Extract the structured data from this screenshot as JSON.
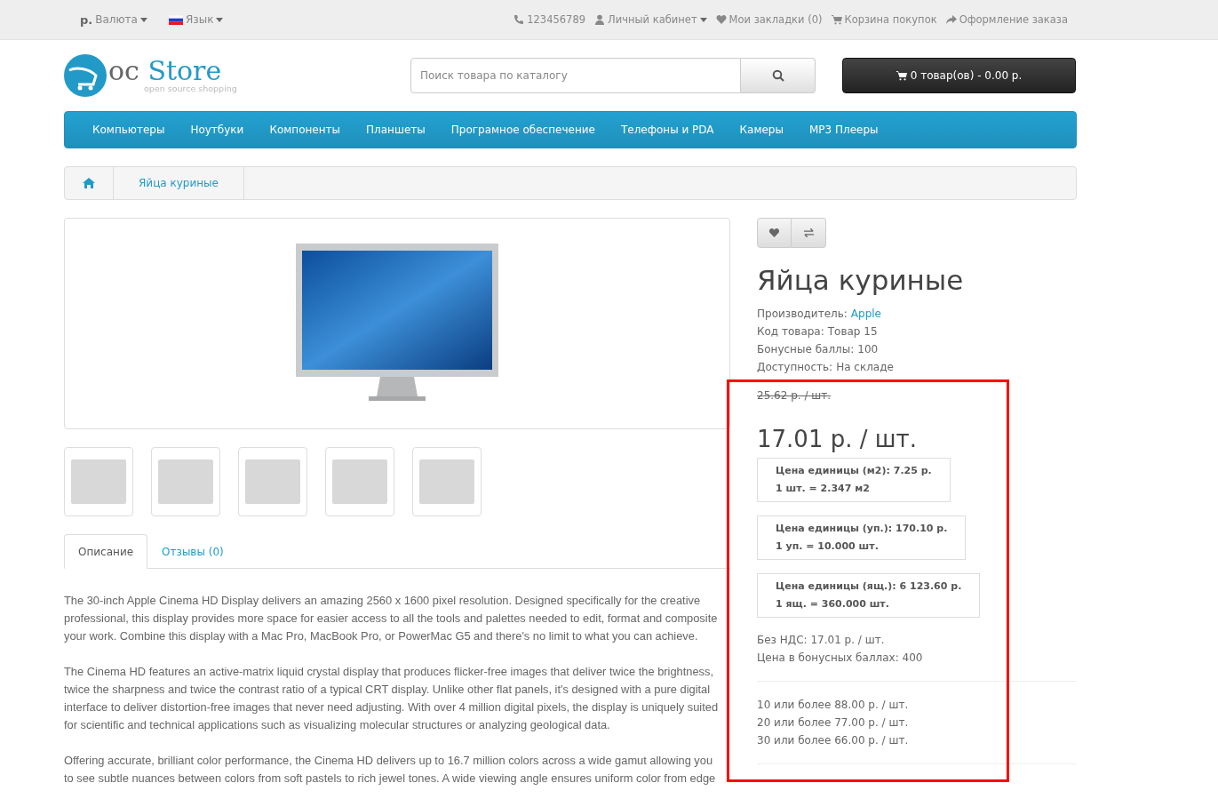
{
  "top_bar": {
    "currency": {
      "symbol": "р.",
      "label": "Валюта"
    },
    "language": {
      "label": "Язык"
    },
    "links": [
      {
        "kind": "phone",
        "label": "123456789",
        "dropdown": false
      },
      {
        "kind": "user",
        "label": "Личный кабинет",
        "dropdown": true
      },
      {
        "kind": "heart",
        "label": "Мои закладки (0)",
        "dropdown": false
      },
      {
        "kind": "cart",
        "label": "Корзина покупок",
        "dropdown": false
      },
      {
        "kind": "share",
        "label": "Оформление заказа",
        "dropdown": false
      }
    ]
  },
  "header": {
    "logo": {
      "prefix": "oc",
      "name": "Store",
      "tagline": "open source shopping"
    },
    "search": {
      "placeholder": "Поиск товара по каталогу"
    },
    "cart": {
      "label": "0 товар(ов) - 0.00 р."
    }
  },
  "menu": [
    "Компьютеры",
    "Ноутбуки",
    "Компоненты",
    "Планшеты",
    "Програмное обеспечение",
    "Телефоны и PDA",
    "Камеры",
    "MP3 Плееры"
  ],
  "breadcrumb": [
    {
      "label": "Яйца куриные"
    }
  ],
  "tabs": [
    {
      "label": "Описание",
      "selected": true
    },
    {
      "label": "Отзывы (0)",
      "selected": false
    }
  ],
  "description": [
    "The 30-inch Apple Cinema HD Display delivers an amazing 2560 x 1600 pixel resolution. Designed specifically for the creative professional, this display provides more space for easier access to all the tools and palettes needed to edit, format and composite your work. Combine this display with a Mac Pro, MacBook Pro, or PowerMac G5 and there's no limit to what you can achieve.",
    "The Cinema HD features an active-matrix liquid crystal display that produces flicker-free images that deliver twice the brightness, twice the sharpness and twice the contrast ratio of a typical CRT display. Unlike other flat panels, it's designed with a pure digital interface to deliver distortion-free images that never need adjusting. With over 4 million digital pixels, the display is uniquely suited for scientific and technical applications such as visualizing molecular structures or analyzing geological data.",
    "Offering accurate, brilliant color performance, the Cinema HD delivers up to 16.7 million colors across a wide gamut allowing you to see subtle nuances between colors from soft pastels to rich jewel tones. A wide viewing angle ensures uniform color from edge"
  ],
  "product": {
    "title": "Яйца куриные",
    "attributes": [
      {
        "label": "Производитель:",
        "value": "Apple",
        "link": true
      },
      {
        "label": "Код товара:",
        "value": "Товар 15",
        "link": false
      },
      {
        "label": "Бонусные баллы:",
        "value": "100",
        "link": false
      },
      {
        "label": "Доступность:",
        "value": "На складе",
        "link": false
      }
    ],
    "old_price": "25.62 р. / шт.",
    "price": "17.01 р. / шт.",
    "unit_prices": [
      {
        "price": "Цена единицы (м2): 7.25 р.",
        "ratio": "1 шт. = 2.347 м2"
      },
      {
        "price": "Цена единицы (уп.): 170.10 р.",
        "ratio": "1 уп. = 10.000 шт."
      },
      {
        "price": "Цена единицы (ящ.): 6 123.60 р.",
        "ratio": "1 ящ. = 360.000 шт."
      }
    ],
    "tax": "Без НДС: 17.01 р. / шт.",
    "points": "Цена в бонусных баллах: 400",
    "discounts": [
      "10 или более 88.00 р. / шт.",
      "20 или более 77.00 р. / шт.",
      "30 или более 66.00 р. / шт."
    ]
  }
}
